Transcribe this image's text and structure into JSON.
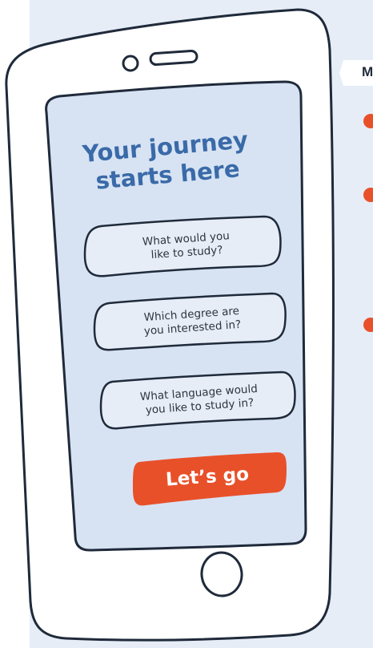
{
  "side_panel": {
    "tab_label": "M"
  },
  "screen": {
    "title_line1": "Your journey",
    "title_line2": "starts here",
    "questions": [
      {
        "line1": "What would you",
        "line2": "like to study?"
      },
      {
        "line1": "Which degree are",
        "line2": "you interested in?"
      },
      {
        "line1": "What language would",
        "line2": "you like to study in?"
      }
    ],
    "cta_label": "Let’s go"
  },
  "colors": {
    "background": "#e6edf7",
    "screen": "#d7e3f3",
    "title": "#3a6aa8",
    "accent": "#e8502a",
    "outline": "#1f2a3a"
  }
}
